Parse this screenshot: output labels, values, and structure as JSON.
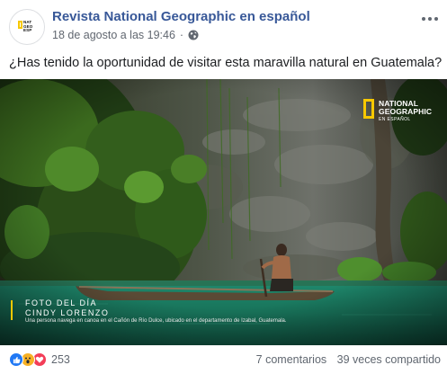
{
  "post": {
    "page_name": "Revista National Geographic en español",
    "timestamp": "18 de agosto a las 19:46",
    "separator": "·",
    "privacy_icon": "globe-icon",
    "caption": "¿Has tenido la oportunidad de visitar esta maravilla natural en Guatemala?",
    "avatar_text": "NATIONAL\nGEOGRAPHIC\nEN ESPAÑOL"
  },
  "photo": {
    "logo_text": "NATIONAL\nGEOGRAPHIC",
    "logo_sub": "EN ESPAÑOL",
    "credit_title": "FOTO DEL DÍA",
    "credit_author": "CINDY LORENZO",
    "credit_desc": "Una persona navega en canoa en el Cañón de Río Dulce, ubicado en el departamento de Izabal, Guatemala."
  },
  "footer": {
    "reaction_icons": [
      "like-icon",
      "wow-icon",
      "love-icon"
    ],
    "reaction_count": "253",
    "comments": "7 comentarios",
    "shares": "39 veces compartido"
  },
  "colors": {
    "link": "#385898",
    "ng_yellow": "#f7c800",
    "like": "#2078f4",
    "wow": "#f7b125",
    "love": "#f33e58"
  }
}
